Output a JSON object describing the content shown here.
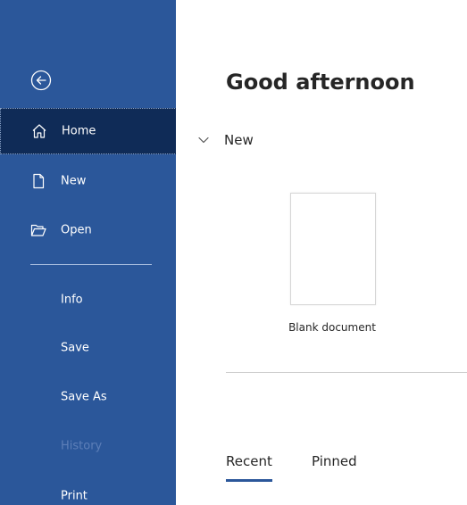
{
  "sidebar": {
    "back_icon": "back-arrow-icon",
    "items": [
      {
        "label": "Home",
        "icon": "home-icon",
        "selected": true
      },
      {
        "label": "New",
        "icon": "new-document-icon"
      },
      {
        "label": "Open",
        "icon": "folder-open-icon"
      },
      {
        "label": "Info"
      },
      {
        "label": "Save"
      },
      {
        "label": "Save As"
      },
      {
        "label": "History",
        "disabled": true
      },
      {
        "label": "Print"
      }
    ],
    "background_color": "#2b579a",
    "selected_color": "#0f2b57"
  },
  "main": {
    "greeting": "Good afternoon",
    "new_section": {
      "label": "New",
      "templates": [
        {
          "label": "Blank document"
        }
      ]
    },
    "tabs": [
      {
        "label": "Recent",
        "active": true
      },
      {
        "label": "Pinned"
      }
    ]
  }
}
